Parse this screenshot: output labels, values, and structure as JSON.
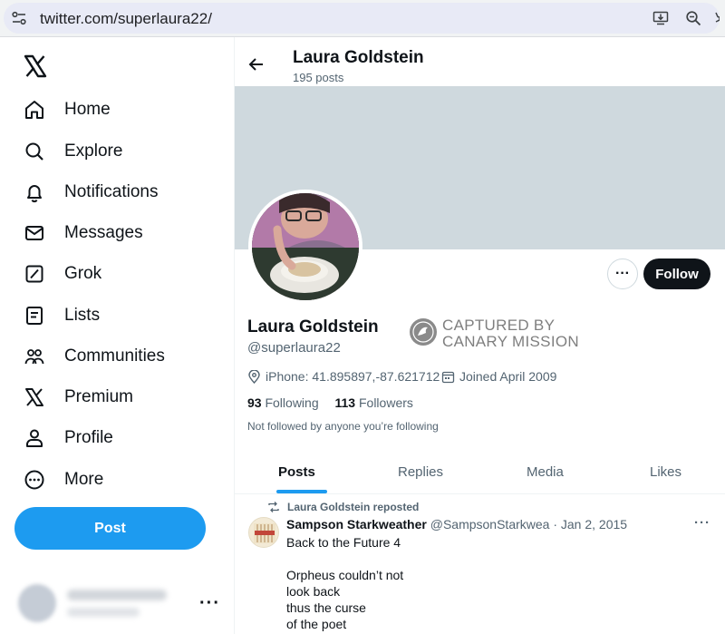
{
  "browser": {
    "url": "twitter.com/superlaura22/",
    "icons": [
      "site-settings-icon",
      "install-app-icon",
      "zoom-icon",
      "bookmark-star-icon"
    ]
  },
  "sidebar": {
    "logo": "x-logo",
    "items": [
      {
        "label": "Home",
        "icon": "home-icon"
      },
      {
        "label": "Explore",
        "icon": "search-icon"
      },
      {
        "label": "Notifications",
        "icon": "bell-icon"
      },
      {
        "label": "Messages",
        "icon": "envelope-icon"
      },
      {
        "label": "Grok",
        "icon": "grok-icon"
      },
      {
        "label": "Lists",
        "icon": "list-icon"
      },
      {
        "label": "Communities",
        "icon": "people-icon"
      },
      {
        "label": "Premium",
        "icon": "x-icon"
      },
      {
        "label": "Profile",
        "icon": "person-icon"
      },
      {
        "label": "More",
        "icon": "more-circle-icon"
      }
    ],
    "post_label": "Post",
    "account_more": "···"
  },
  "header": {
    "name": "Laura Goldstein",
    "post_count": "195 posts"
  },
  "profile": {
    "display_name": "Laura Goldstein",
    "handle": "@superlaura22",
    "more_label": "···",
    "follow_label": "Follow",
    "stamp_line1": "CAPTURED BY",
    "stamp_line2": "CANARY MISSION",
    "location": "iPhone: 41.895897,-87.621712",
    "joined": "Joined April 2009",
    "following_count": "93",
    "following_label": "Following",
    "followers_count": "113",
    "followers_label": "Followers",
    "not_followed": "Not followed by anyone you’re following"
  },
  "tabs": [
    "Posts",
    "Replies",
    "Media",
    "Likes"
  ],
  "tweet": {
    "repost_label": "Laura Goldstein reposted",
    "author": "Sampson Starkweather",
    "handle_date": "@SampsonStarkwea · Jan 2, 2015",
    "more": "···",
    "lines": [
      "Back to the Future 4",
      "",
      "Orpheus couldn’t not",
      "look back",
      "thus the curse",
      "of the poet"
    ]
  },
  "colors": {
    "accent": "#1d9bf0",
    "banner": "#cfd9de",
    "text": "#0f1419",
    "muted": "#536471",
    "follow_button": "#0f1419"
  }
}
